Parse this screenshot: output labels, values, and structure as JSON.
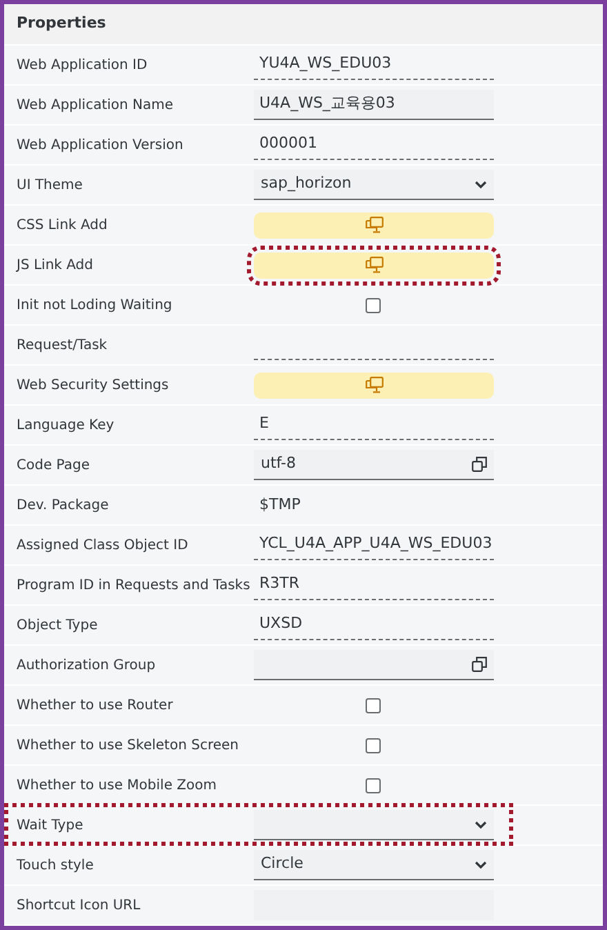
{
  "panel": {
    "title": "Properties"
  },
  "rows": [
    {
      "label": "Web Application ID",
      "kind": "text",
      "value": "YU4A_WS_EDU03"
    },
    {
      "label": "Web Application Name",
      "kind": "input",
      "value": "U4A_WS_교육용03"
    },
    {
      "label": "Web Application Version",
      "kind": "text",
      "value": "000001"
    },
    {
      "label": "UI Theme",
      "kind": "select",
      "value": "sap_horizon"
    },
    {
      "label": "CSS Link Add",
      "kind": "button",
      "highlighted": false
    },
    {
      "label": "JS Link Add",
      "kind": "button",
      "highlighted": true
    },
    {
      "label": "Init not Loding Waiting",
      "kind": "checkbox",
      "checked": false
    },
    {
      "label": "Request/Task",
      "kind": "text"
    },
    {
      "label": "Web Security Settings",
      "kind": "button",
      "highlighted": false
    },
    {
      "label": "Language Key",
      "kind": "text",
      "value": "E"
    },
    {
      "label": "Code Page",
      "kind": "valuehelp",
      "value": "utf-8"
    },
    {
      "label": "Dev. Package",
      "kind": "display",
      "value": "$TMP"
    },
    {
      "label": "Assigned Class Object ID",
      "kind": "text",
      "value": "YCL_U4A_APP_U4A_WS_EDU03"
    },
    {
      "label": "Program ID in Requests and Tasks",
      "kind": "text",
      "value": "R3TR"
    },
    {
      "label": "Object Type",
      "kind": "text",
      "value": "UXSD"
    },
    {
      "label": "Authorization Group",
      "kind": "valuehelp"
    },
    {
      "label": "Whether to use Router",
      "kind": "checkbox",
      "checked": false
    },
    {
      "label": "Whether to use Skeleton Screen",
      "kind": "checkbox",
      "checked": false
    },
    {
      "label": "Whether to use Mobile Zoom",
      "kind": "checkbox",
      "checked": false
    },
    {
      "label": "Wait Type",
      "kind": "select",
      "highlighted": true
    },
    {
      "label": "Touch style",
      "kind": "select",
      "value": "Circle"
    },
    {
      "label": "Shortcut Icon URL",
      "kind": "blank"
    }
  ]
}
